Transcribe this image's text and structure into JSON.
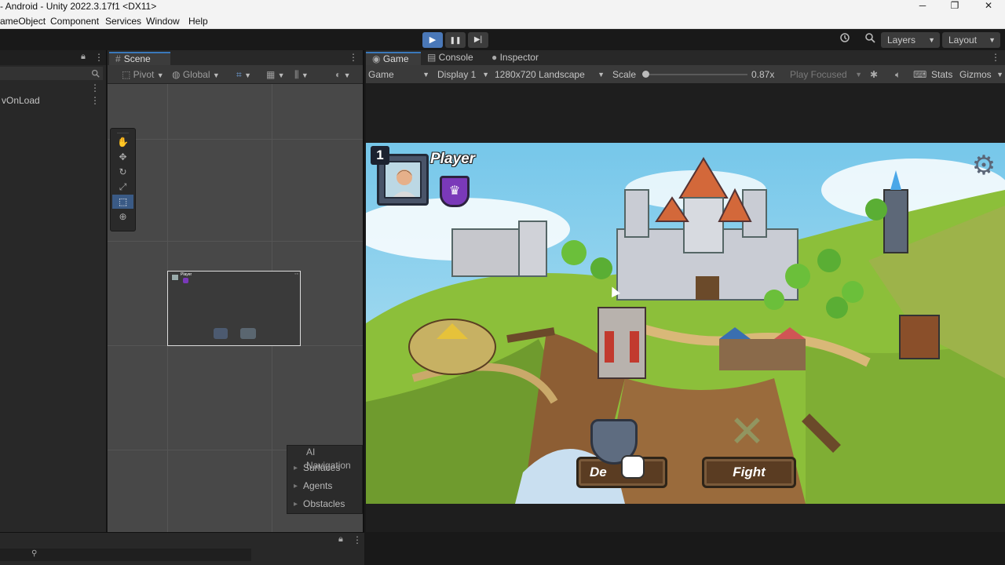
{
  "window": {
    "title": "- Android - Unity 2022.3.17f1 <DX11>",
    "controls": {
      "minimize": "─",
      "maximize": "❐",
      "close": "✕"
    }
  },
  "menu": [
    "ameObject",
    "Component",
    "Services",
    "Window",
    "Help"
  ],
  "toolbar": {
    "play_icon": "▶",
    "pause_icon": "❚❚",
    "step_icon": "▶|",
    "history_icon": "history-icon",
    "search_icon": "search-icon",
    "layers_label": "Layers",
    "layout_label": "Layout",
    "more_icon": "⋮"
  },
  "hierarchy": {
    "rows": [
      "vOnLoad"
    ]
  },
  "scene": {
    "tab_label": "Scene",
    "pivot_label": "Pivot",
    "global_label": "Global",
    "tools": [
      "hand-tool",
      "move-tool",
      "rotate-tool",
      "scale-tool",
      "rect-tool",
      "transform-tool"
    ],
    "selected_tool": 4,
    "mini_player_label": "Player",
    "ai_navigation": {
      "title": "AI Navigation",
      "items": [
        "Surfaces",
        "Agents",
        "Obstacles"
      ]
    }
  },
  "game_panel": {
    "tabs": [
      "Game",
      "Console",
      "Inspector"
    ],
    "active_tab": 0,
    "display_mode": "Game",
    "display": "Display 1",
    "resolution": "1280x720 Landscape",
    "scale_label": "Scale",
    "scale_value": "0.87x",
    "scale_fraction": 0.0,
    "play_focused": "Play Focused",
    "stats_label": "Stats",
    "gizmos_label": "Gizmos"
  },
  "game_view": {
    "player_level": "1",
    "player_name": "Player",
    "buttons": {
      "defend": "De",
      "fight": "Fight"
    },
    "colors": {
      "sky": "#8ad0ec",
      "grass": "#8fc03a",
      "cliff": "#9a6b3c",
      "castle_stone": "#c9ccd4",
      "roof": "#d3683a",
      "badge_purple": "#7a39b9",
      "button_brown": "#5a3c22"
    }
  }
}
